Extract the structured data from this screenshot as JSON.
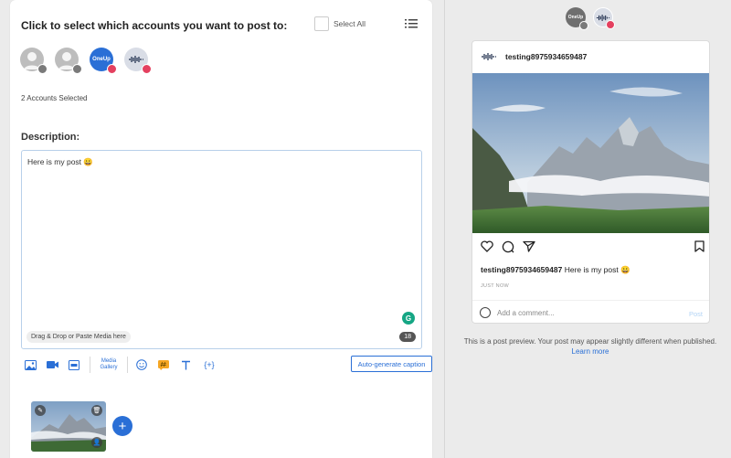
{
  "composer": {
    "heading": "Click to select which accounts you want to post to:",
    "select_all_label": "Select All",
    "accounts_selected": "2 Accounts Selected",
    "description_label": "Description:",
    "post_text": "Here is my post 😀",
    "dropzone_label": "Drag & Drop or Paste Media here",
    "char_count": "18",
    "media_gallery_label": "Media Gallery",
    "auto_caption_label": "Auto-generate caption",
    "add_icon": "+",
    "oneup_label": "OneUp"
  },
  "preview": {
    "oneup_label": "OneUp",
    "username": "testing8975934659487",
    "caption": "Here is my post 😀",
    "time": "JUST NOW",
    "comment_placeholder": "Add a comment...",
    "post_label": "Post",
    "note": "This is a post preview. Your post may appear slightly different when published.",
    "learn_more": "Learn more"
  },
  "colors": {
    "accent": "#2a6fd6",
    "instagram": "#e4405f",
    "grammarly": "#15a684"
  }
}
